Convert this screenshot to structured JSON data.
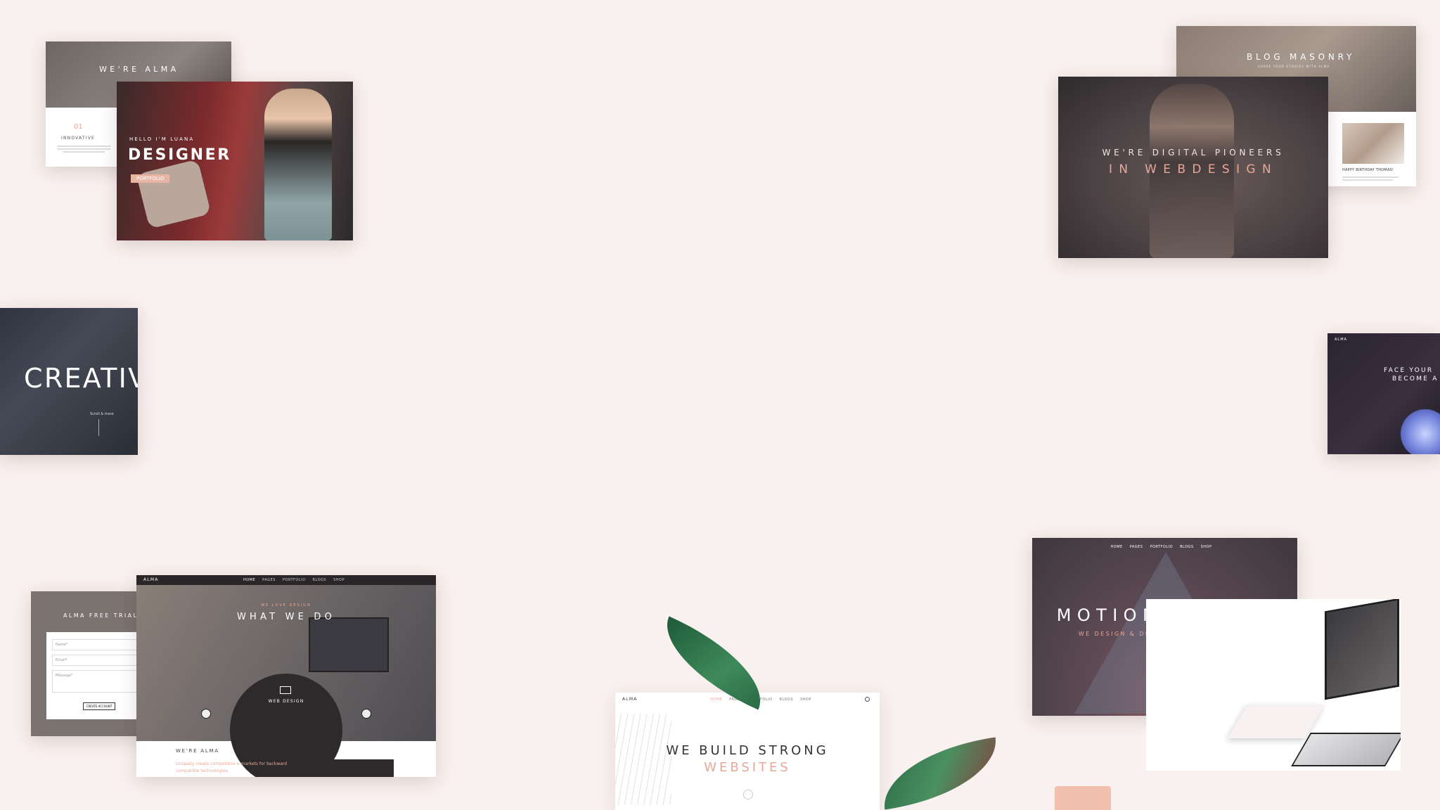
{
  "tile_alma_intro": {
    "title": "WE'RE ALMA",
    "num": "01",
    "heading": "INNOVATIVE"
  },
  "tile_designer": {
    "hello": "HELLO I'M LUANA",
    "title": "DESIGNER",
    "button": "PORTFOLIO"
  },
  "tile_blog": {
    "title": "BLOG MASONRY",
    "subtitle": "SHARE YOUR STORIES WITH ALMA",
    "post_title": "HAPPY BIRTHDAY THOMAS!"
  },
  "tile_pioneers": {
    "line1": "WE'RE DIGITAL PIONEERS",
    "line2": "IN WEBDESIGN"
  },
  "tile_creative": {
    "title": "CREATIVE",
    "scroll": "Scroll & more"
  },
  "tile_face": {
    "logo": "ALMA",
    "line1": "FACE YOUR",
    "line2": "BECOME A"
  },
  "tile_trial": {
    "title": "ALMA FREE TRIAL",
    "fields": [
      "Name*",
      "Email*",
      "Message*"
    ],
    "button": "CREATE ACCOUNT"
  },
  "tile_whatwedo": {
    "logo": "ALMA",
    "nav": [
      "HOME",
      "PAGES",
      "PORTFOLIO",
      "BLOGS",
      "SHOP"
    ],
    "eyebrow": "WE LOVE DESIGN",
    "title": "WHAT WE DO",
    "circle_title": "WEB DESIGN",
    "section_title": "WE'RE ALMA",
    "section_text": "Uniquely create competitive e-markets for backward compatible technologies."
  },
  "tile_motion": {
    "nav": [
      "HOME",
      "PAGES",
      "PORTFOLIO",
      "BLOGS",
      "SHOP"
    ],
    "title": "MOTION DESIGN",
    "subtitle": "WE DESIGN & DEVELOP CREATIVE STUFF"
  },
  "tile_websites": {
    "logo": "ALMA",
    "nav": [
      "HOME",
      "PAGES",
      "PORTFOLIO",
      "BLOGS",
      "SHOP"
    ],
    "line1": "WE BUILD STRONG",
    "line2": "WEBSITES"
  },
  "colors": {
    "background": "#f9f1ef",
    "accent": "#e8a898",
    "dark": "#3a3538"
  }
}
